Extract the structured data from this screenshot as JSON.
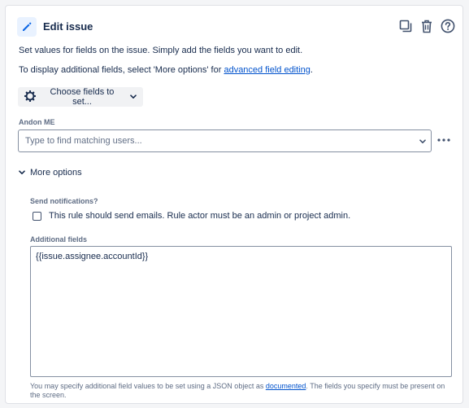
{
  "header": {
    "title": "Edit issue",
    "icons": [
      "pencil-icon",
      "duplicate-icon",
      "trash-icon",
      "help-icon"
    ]
  },
  "description": {
    "line1": "Set values for fields on the issue. Simply add the fields you want to edit.",
    "line2_prefix": "To display additional fields, select 'More options' for ",
    "line2_link": "advanced field editing",
    "line2_suffix": "."
  },
  "choose_fields": {
    "label": "Choose fields to set..."
  },
  "andon": {
    "label": "Andon ME",
    "placeholder": "Type to find matching users...",
    "value": ""
  },
  "more_options": {
    "label": "More options"
  },
  "notifications": {
    "label": "Send notifications?",
    "checkbox_label": "This rule should send emails. Rule actor must be an admin or project admin.",
    "checked": false
  },
  "additional_fields": {
    "label": "Additional fields",
    "value": "{{issue.assignee.accountId}}",
    "help_prefix": "You may specify additional field values to be set using a JSON object as ",
    "help_link": "documented",
    "help_suffix": ". The fields you specify must be present on the screen."
  },
  "colors": {
    "accent": "#0c66e4",
    "link": "#0052cc",
    "text": "#172b4d",
    "subtle_text": "#5e6c84",
    "border": "#8590a2",
    "button_bg": "#f1f2f4"
  }
}
